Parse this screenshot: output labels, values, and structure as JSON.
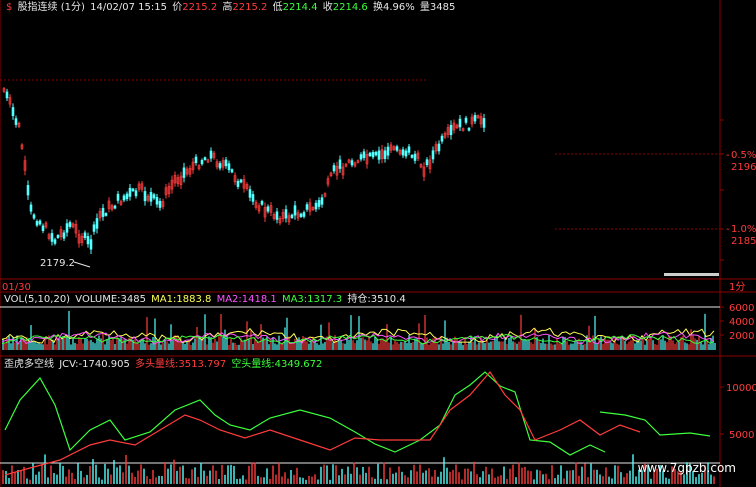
{
  "header": {
    "badge": "$",
    "title": "股指连续 (1分)",
    "datetime": "14/02/07 15:15",
    "price_label": "价",
    "price": "2215.2",
    "high_label": "高",
    "high": "2215.2",
    "low_label": "低",
    "low": "2214.4",
    "close_label": "收",
    "close": "2214.6",
    "turnover_label": "换",
    "turnover": "4.96%",
    "volume_label": "量",
    "volume": "3485"
  },
  "price_axis": {
    "pct_up": "0.5%",
    "level_up": "2196",
    "pct_down": "1.0%",
    "level_down": "2185"
  },
  "price_chart": {
    "low_annotation": "2179.2",
    "date_label": "01/30",
    "period_label": "1分"
  },
  "volume_panel": {
    "label": "VOL(5,10,20)",
    "volume": "VOLUME:3485",
    "ma1": "MA1:1883.8",
    "ma2": "MA2:1418.1",
    "ma3": "MA3:1317.3",
    "hold": "持仓:3510.4",
    "axis": [
      "6000",
      "4000",
      "2000"
    ]
  },
  "jcv_panel": {
    "label": "歪虎多空线",
    "jcv": "JCV:-1740.905",
    "long_label": "多头量线:3513.797",
    "short_label": "空头量线:4349.672",
    "axis": [
      "10000",
      "5000"
    ]
  },
  "colors": {
    "up": "#ff3c3c",
    "down": "#3cff3c",
    "white": "#e6e6e6",
    "cyan": "#54ffff",
    "grid": "#8b0000"
  },
  "watermark": "www.7gpzb.com"
}
